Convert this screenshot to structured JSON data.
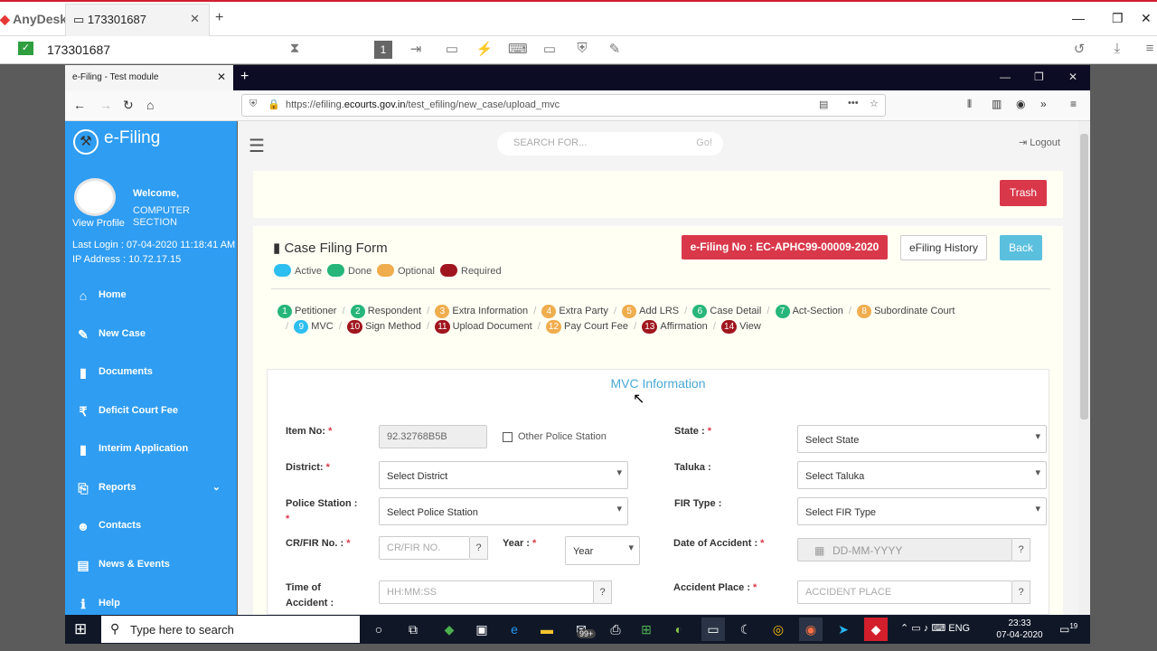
{
  "anydesk": {
    "app_name": "AnyDesk",
    "tab_title": "173301687",
    "address": "173301687"
  },
  "browser": {
    "tab_title": "e-Filing - Test module",
    "url_prefix": "https://efiling.",
    "url_domain": "ecourts.gov.in",
    "url_path": "/test_efiling/new_case/upload_mvc"
  },
  "sidebar": {
    "brand": "e-Filing",
    "welcome": "Welcome,",
    "user_name": "COMPUTER SECTION",
    "view_profile": "View Profile",
    "last_login": "Last Login : 07-04-2020 11:18:41 AM",
    "ip_address": "IP Address : 10.72.17.15",
    "items": [
      {
        "label": "Home",
        "icon": "home-icon",
        "glyph": "⌂"
      },
      {
        "label": "New Case",
        "icon": "pencil-icon",
        "glyph": "✎"
      },
      {
        "label": "Documents",
        "icon": "document-icon",
        "glyph": "▮"
      },
      {
        "label": "Deficit Court Fee",
        "icon": "rupee-icon",
        "glyph": "₹"
      },
      {
        "label": "Interim Application",
        "icon": "document-icon",
        "glyph": "▮"
      },
      {
        "label": "Reports",
        "icon": "reports-icon",
        "glyph": "⎘"
      },
      {
        "label": "Contacts",
        "icon": "users-icon",
        "glyph": "☻"
      },
      {
        "label": "News & Events",
        "icon": "news-icon",
        "glyph": "▤"
      },
      {
        "label": "Help",
        "icon": "info-icon",
        "glyph": "ℹ"
      }
    ]
  },
  "header": {
    "search_placeholder": "SEARCH FOR...",
    "search_go": "Go!",
    "logout": "Logout"
  },
  "buttons": {
    "trash": "Trash",
    "efiling_no": "e-Filing No : EC-APHC99-00009-2020",
    "history": "eFiling History",
    "back": "Back"
  },
  "form": {
    "title": "Case Filing Form",
    "legend": [
      {
        "label": "Active",
        "color": "#2ebff0"
      },
      {
        "label": "Done",
        "color": "#26b67a"
      },
      {
        "label": "Optional",
        "color": "#f0ad4e"
      },
      {
        "label": "Required",
        "color": "#a0161e"
      }
    ],
    "steps": [
      {
        "num": "1",
        "label": "Petitioner",
        "color": "#26b67a"
      },
      {
        "num": "2",
        "label": "Respondent",
        "color": "#26b67a"
      },
      {
        "num": "3",
        "label": "Extra Information",
        "color": "#f0ad4e"
      },
      {
        "num": "4",
        "label": "Extra Party",
        "color": "#f0ad4e"
      },
      {
        "num": "5",
        "label": "Add LRS",
        "color": "#f0ad4e"
      },
      {
        "num": "6",
        "label": "Case Detail",
        "color": "#26b67a"
      },
      {
        "num": "7",
        "label": "Act-Section",
        "color": "#26b67a"
      },
      {
        "num": "8",
        "label": "Subordinate Court",
        "color": "#f0ad4e"
      },
      {
        "num": "9",
        "label": "MVC",
        "color": "#2ebff0"
      },
      {
        "num": "10",
        "label": "Sign Method",
        "color": "#a0161e"
      },
      {
        "num": "11",
        "label": "Upload Document",
        "color": "#a0161e"
      },
      {
        "num": "12",
        "label": "Pay Court Fee",
        "color": "#f0ad4e"
      },
      {
        "num": "13",
        "label": "Affirmation",
        "color": "#a0161e"
      },
      {
        "num": "14",
        "label": "View",
        "color": "#a0161e"
      }
    ]
  },
  "mvc": {
    "title": "MVC Information",
    "item_no_label": "Item No:",
    "item_no_value": "92.32768B5B",
    "other_police_label": "Other Police Station",
    "state_label": "State :",
    "state_value": "Select State",
    "district_label": "District:",
    "district_value": "Select District",
    "taluka_label": "Taluka :",
    "taluka_value": "Select Taluka",
    "police_label": "Police Station :",
    "police_value": "Select Police Station",
    "fir_type_label": "FIR Type :",
    "fir_type_value": "Select FIR Type",
    "crfir_label": "CR/FIR No. :",
    "crfir_placeholder": "CR/FIR NO.",
    "year_label": "Year :",
    "year_value": "Year",
    "doa_label": "Date of Accident :",
    "doa_placeholder": "DD-MM-YYYY",
    "time_label_1": "Time of",
    "time_label_2": "Accident :",
    "time_placeholder": "HH:MM:SS",
    "place_label": "Accident Place :",
    "place_placeholder": "ACCIDENT PLACE",
    "required_mark": "*"
  },
  "taskbar": {
    "search": "Type here to search",
    "lang": "ENG",
    "time": "23:33",
    "date": "07-04-2020",
    "badge": "99+",
    "notif": "19"
  }
}
